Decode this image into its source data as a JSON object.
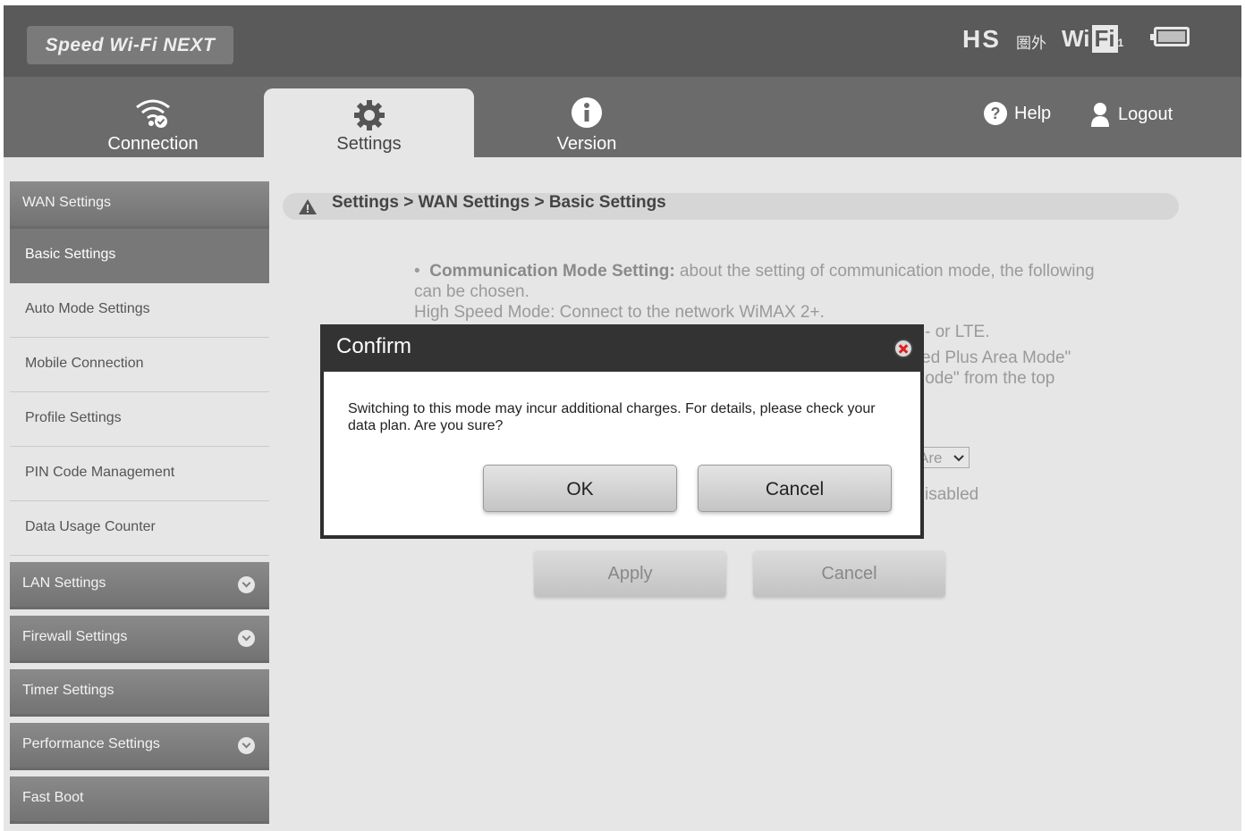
{
  "header": {
    "logo": "Speed Wi-Fi NEXT",
    "status": {
      "hs": "HS",
      "area": "圏外",
      "wifi": "Wi",
      "wifi_box": "Fi",
      "wifi_sub": "1"
    }
  },
  "nav": {
    "tabs": [
      {
        "label": "Connection",
        "icon": "wifi-icon"
      },
      {
        "label": "Settings",
        "icon": "gear-icon"
      },
      {
        "label": "Version",
        "icon": "info-icon"
      }
    ],
    "help": "Help",
    "logout": "Logout"
  },
  "sidebar": {
    "items": [
      {
        "label": "WAN Settings"
      },
      {
        "label": "Basic Settings"
      },
      {
        "label": "Auto Mode Settings"
      },
      {
        "label": "Mobile Connection"
      },
      {
        "label": "Profile Settings"
      },
      {
        "label": "PIN Code Management"
      },
      {
        "label": "Data Usage Counter"
      },
      {
        "label": "LAN Settings"
      },
      {
        "label": "Firewall Settings"
      },
      {
        "label": "Timer Settings"
      },
      {
        "label": "Performance Settings"
      },
      {
        "label": "Fast Boot"
      }
    ]
  },
  "breadcrumb": "Settings > WAN Settings > Basic Settings",
  "content": {
    "bullet_title": "Communication Mode Setting:",
    "bullet_text": " about the setting of communication mode, the following can be chosen.",
    "line2": "High Speed Mode: Connect to the network WiMAX 2+.",
    "frag1": "- or LTE.",
    "frag2": "ed Plus Area Mode\"",
    "frag3": "lode\" from the top",
    "select_value": "Are",
    "frag4": "isabled",
    "apply": "Apply",
    "cancel": "Cancel"
  },
  "dialog": {
    "title": "Confirm",
    "message": "Switching to this mode may incur additional charges. For details, please check your data plan. Are you sure?",
    "ok": "OK",
    "cancel": "Cancel"
  }
}
